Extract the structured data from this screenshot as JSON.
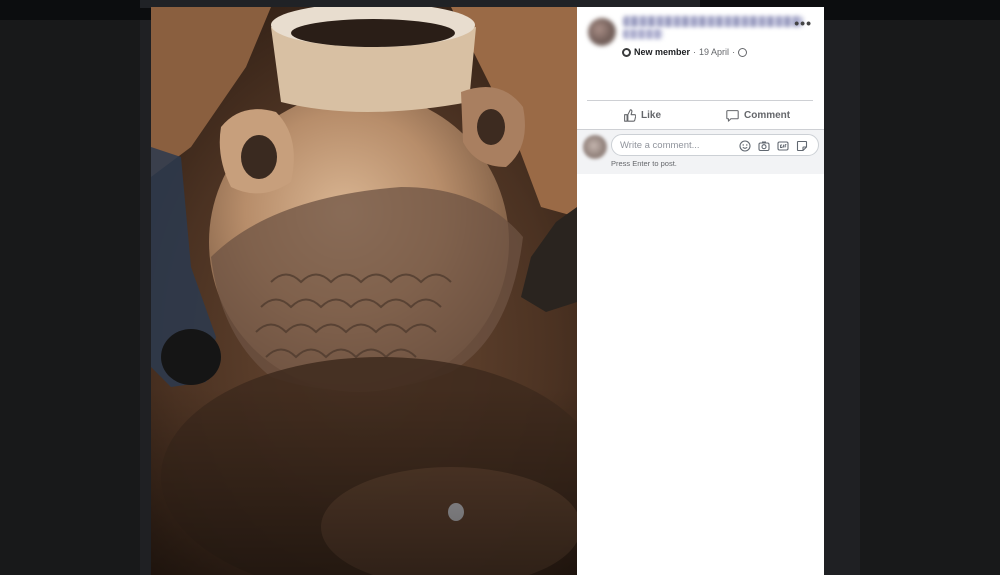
{
  "post": {
    "badge_label": "New member",
    "date": "19 April",
    "more_label": "•••"
  },
  "actions": {
    "like_label": "Like",
    "comment_label": "Comment"
  },
  "composer": {
    "placeholder": "Write a comment...",
    "hint": "Press Enter to post.",
    "icons": [
      "emoji-icon",
      "camera-icon",
      "gif-icon",
      "sticker-icon"
    ]
  },
  "photo": {
    "subject": "excavated clay jar"
  },
  "colors": {
    "panel_bg": "#ffffff",
    "page_bg": "#18191a",
    "text_secondary": "#65676b",
    "composer_bg": "#f2f3f5"
  }
}
